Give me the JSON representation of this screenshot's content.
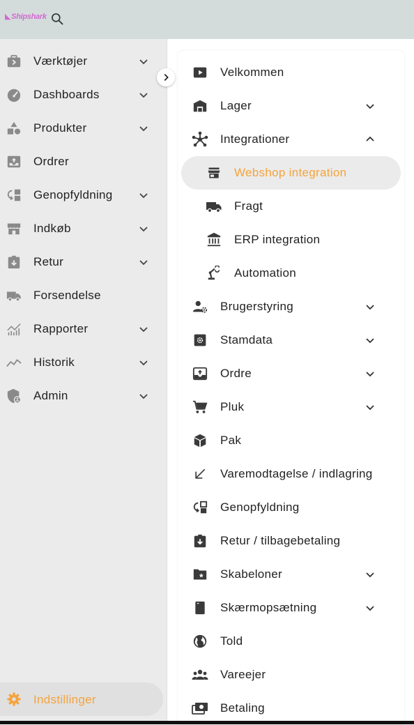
{
  "header": {
    "logo_text": "Shipshark",
    "search_icon": "search-icon"
  },
  "sidebar": {
    "items": [
      {
        "label": "Værktøjer",
        "icon": "tools-icon",
        "expandable": true
      },
      {
        "label": "Dashboards",
        "icon": "speedometer-icon",
        "expandable": true
      },
      {
        "label": "Produkter",
        "icon": "shapes-icon",
        "expandable": true
      },
      {
        "label": "Ordrer",
        "icon": "inbox-upload-icon",
        "expandable": false
      },
      {
        "label": "Genopfyldning",
        "icon": "replenish-icon",
        "expandable": true
      },
      {
        "label": "Indkøb",
        "icon": "storefront-icon",
        "expandable": true
      },
      {
        "label": "Retur",
        "icon": "return-box-icon",
        "expandable": true
      },
      {
        "label": "Forsendelse",
        "icon": "truck-icon",
        "expandable": false
      },
      {
        "label": "Rapporter",
        "icon": "chart-bars-icon",
        "expandable": true
      },
      {
        "label": "Historik",
        "icon": "trend-line-icon",
        "expandable": true
      },
      {
        "label": "Admin",
        "icon": "admin-shield-icon",
        "expandable": true
      }
    ],
    "settings": {
      "label": "Indstillinger",
      "icon": "gear-icon",
      "active": true
    },
    "collapse_icon": "chevron-right-icon"
  },
  "panel": {
    "items": [
      {
        "label": "Velkommen",
        "icon": "play-icon",
        "chevron": "none"
      },
      {
        "label": "Lager",
        "icon": "warehouse-icon",
        "chevron": "down"
      },
      {
        "label": "Integrationer",
        "icon": "hub-icon",
        "chevron": "up"
      },
      {
        "label": "Webshop integration",
        "icon": "store-icon",
        "sub": true,
        "active": true
      },
      {
        "label": "Fragt",
        "icon": "truck-icon",
        "sub": true
      },
      {
        "label": "ERP integration",
        "icon": "bank-icon",
        "sub": true
      },
      {
        "label": "Automation",
        "icon": "robot-arm-icon",
        "sub": true
      },
      {
        "label": "Brugerstyring",
        "icon": "user-settings-icon",
        "chevron": "down"
      },
      {
        "label": "Stamdata",
        "icon": "settings-box-icon",
        "chevron": "down"
      },
      {
        "label": "Ordre",
        "icon": "inbox-upload-icon",
        "chevron": "down"
      },
      {
        "label": "Pluk",
        "icon": "cart-icon",
        "chevron": "down"
      },
      {
        "label": "Pak",
        "icon": "package-icon",
        "chevron": "none"
      },
      {
        "label": "Varemodtagelse / indlagring",
        "icon": "arrow-down-left-icon",
        "chevron": "none"
      },
      {
        "label": "Genopfyldning",
        "icon": "replenish-icon",
        "chevron": "none"
      },
      {
        "label": "Retur / tilbagebetaling",
        "icon": "return-box-icon",
        "chevron": "none"
      },
      {
        "label": "Skabeloner",
        "icon": "folder-star-icon",
        "chevron": "down"
      },
      {
        "label": "Skærmopsætning",
        "icon": "device-icon",
        "chevron": "down"
      },
      {
        "label": "Told",
        "icon": "globe-icon",
        "chevron": "none"
      },
      {
        "label": "Vareejer",
        "icon": "group-icon",
        "chevron": "none"
      },
      {
        "label": "Betaling",
        "icon": "payments-icon",
        "chevron": "none"
      }
    ]
  },
  "colors": {
    "accent": "#f5a33b",
    "topbar": "#d3dcdb",
    "sidebar": "#ebebeb",
    "sidebar_icon": "#8a8a8a",
    "panel_icon": "#3a3a3a",
    "logo": "#d16ad0"
  }
}
